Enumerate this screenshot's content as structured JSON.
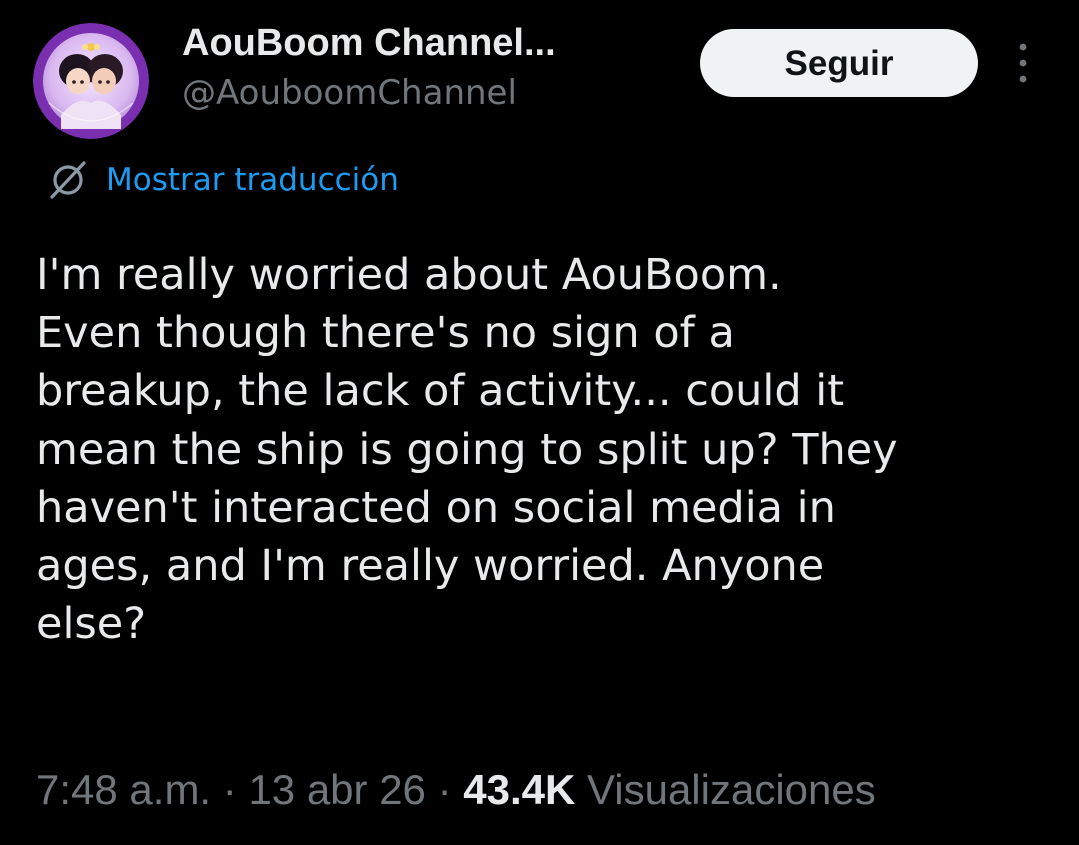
{
  "author": {
    "display_name": "AouBoom Channel...",
    "handle": "@AouboomChannel",
    "avatar_icon": "profile-avatar-illustration"
  },
  "header": {
    "follow_label": "Seguir",
    "more_icon": "vertical-ellipsis-icon"
  },
  "translate": {
    "icon": "globe-slash-icon",
    "label": "Mostrar traducción"
  },
  "tweet": {
    "lines": [
      "I'm really worried about AouBoom.",
      "Even though there's no sign of a",
      "breakup, the lack of activity... could it",
      "mean the ship is going to split up? They",
      "haven't interacted on social media in",
      "ages, and I'm really worried. Anyone",
      "else?"
    ]
  },
  "meta": {
    "time": "7:48 a.m.",
    "separator": " · ",
    "date": "13 abr 26",
    "views_count": "43.4K",
    "views_label": "Visualizaciones"
  },
  "colors": {
    "background": "#000000",
    "text_primary": "#e7e9ea",
    "text_secondary": "#71767b",
    "link_blue": "#1d9bf0",
    "button_bg": "#eff3f4",
    "avatar_ring": "#7a2fb0"
  }
}
